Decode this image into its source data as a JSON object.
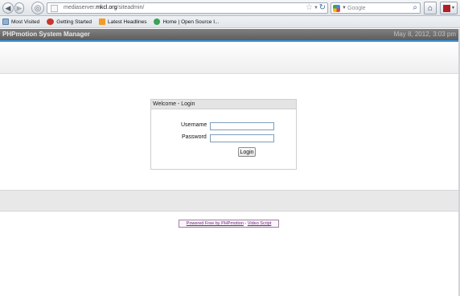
{
  "browser": {
    "url_prefix": "mediaserver.",
    "url_domain": "mkcl.org",
    "url_path": "/siteadmin/",
    "search_placeholder": "Google",
    "bookmarks": [
      {
        "label": "Most Visited",
        "icon": "most-visited-icon"
      },
      {
        "label": "Getting Started",
        "icon": "firefox-icon"
      },
      {
        "label": "Latest Headlines",
        "icon": "rss-feed-icon"
      },
      {
        "label": "Home | Open Source I...",
        "icon": "globe-icon"
      }
    ]
  },
  "header": {
    "title": "PHPmotion System Manager",
    "date": "May 8, 2012, 3:03 pm"
  },
  "login": {
    "title": "Welcome - Login",
    "username_label": "Username",
    "password_label": "Password",
    "username_value": "",
    "password_value": "",
    "submit_label": "Login"
  },
  "footer": {
    "powered_label": "Powered Free by PHPmotion",
    "separator": " - ",
    "video_script_label": "Video Script"
  },
  "colors": {
    "header_bg": "#6e6e6e",
    "accent": "#3a8fd6",
    "credits_text": "#6a2a7a"
  }
}
